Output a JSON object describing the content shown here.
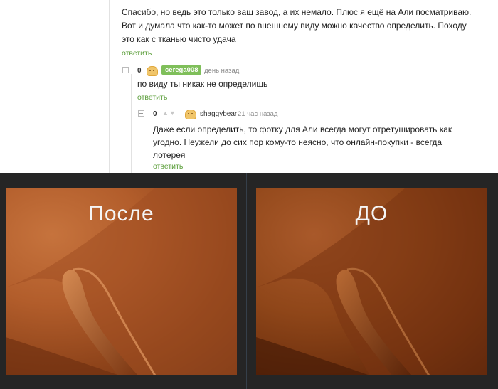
{
  "comments": [
    {
      "text_lines": [
        "Спасибо, но ведь это только ваш завод,  а их немало. Плюс я ещё на Али посматриваю.",
        "Вот и думала что как-то может по внешнему виду можно качество определить. Походу",
        "это как с тканью чисто удача"
      ],
      "reply_label": "ответить"
    },
    {
      "rating": "0",
      "username": "cerega008",
      "time": "день назад",
      "text_lines": [
        "по виду ты никак не определишь"
      ],
      "reply_label": "ответить"
    },
    {
      "rating": "0",
      "username": "shaggybear",
      "time": "21 час назад",
      "text_lines": [
        "Даже если определить, то фотку для Али всегда могут отретушировать как",
        "угодно. Неужели до сих пор кому-то неясно, что онлайн-покупки - всегда",
        "лотерея"
      ],
      "reply_label": "ответить"
    }
  ],
  "photos": {
    "left_label": "После",
    "right_label": "ДО"
  },
  "colors": {
    "link_green": "#5b9e3a",
    "badge_green": "#7fbf5a",
    "dark_background": "#252525"
  }
}
